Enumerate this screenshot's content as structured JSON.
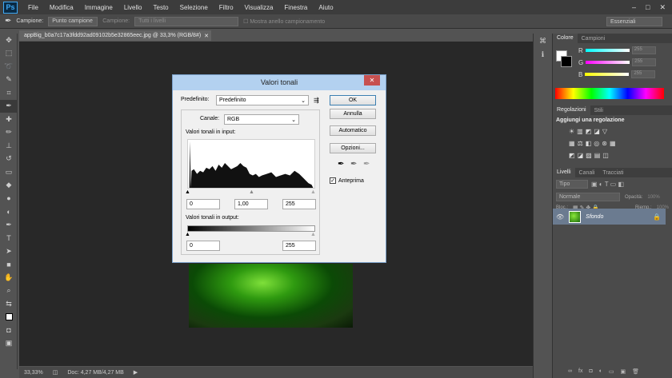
{
  "app": {
    "logo": "Ps",
    "menus": [
      "File",
      "Modifica",
      "Immagine",
      "Livello",
      "Testo",
      "Selezione",
      "Filtro",
      "Visualizza",
      "Finestra",
      "Aiuto"
    ],
    "window_controls": [
      "–",
      "□",
      "✕"
    ]
  },
  "options": {
    "campione_label": "Campione:",
    "campione_value": "Punto campione",
    "campione2_label": "Campione:",
    "campione2_value": "Tutti i livelli",
    "anello": "Mostra anello campionamento",
    "workspace": "Essenziali"
  },
  "document": {
    "tab": "appBig_b0a7c17a3fdd92ad09102b5e32865eec.jpg @ 33,3% (RGB/8#)",
    "zoom": "33,33%",
    "docsize": "Doc: 4,27 MB/4,27 MB"
  },
  "dialog": {
    "title": "Valori tonali",
    "preset_label": "Predefinito:",
    "preset_value": "Predefinito",
    "channel_label": "Canale:",
    "channel_value": "RGB",
    "input_label": "Valori tonali in input:",
    "input_values": [
      "0",
      "1,00",
      "255"
    ],
    "output_label": "Valori tonali in output:",
    "output_values": [
      "0",
      "255"
    ],
    "buttons": {
      "ok": "OK",
      "cancel": "Annulla",
      "auto": "Automatico",
      "options": "Opzioni..."
    },
    "preview": "Anteprima"
  },
  "panels": {
    "color_tabs": [
      "Colore",
      "Campioni"
    ],
    "rgb": [
      {
        "label": "R",
        "value": "255"
      },
      {
        "label": "G",
        "value": "255"
      },
      {
        "label": "B",
        "value": "255"
      }
    ],
    "adj_tabs": [
      "Regolazioni",
      "Stili"
    ],
    "adj_title": "Aggiungi una regolazione",
    "layers_tabs": [
      "Livelli",
      "Canali",
      "Tracciati"
    ],
    "kind": "Tipo",
    "blend": "Normale",
    "opacity_label": "Opacità:",
    "opacity_value": "100%",
    "lock_label": "Bloc.:",
    "fill_label": "Riemp.:",
    "fill_value": "100%",
    "layer_name": "Sfondo"
  },
  "colors": {
    "accent": "#3fa9f5",
    "dialog_title": "#b3d1f0",
    "close": "#c75050",
    "layer_selected": "#6b7b90"
  }
}
